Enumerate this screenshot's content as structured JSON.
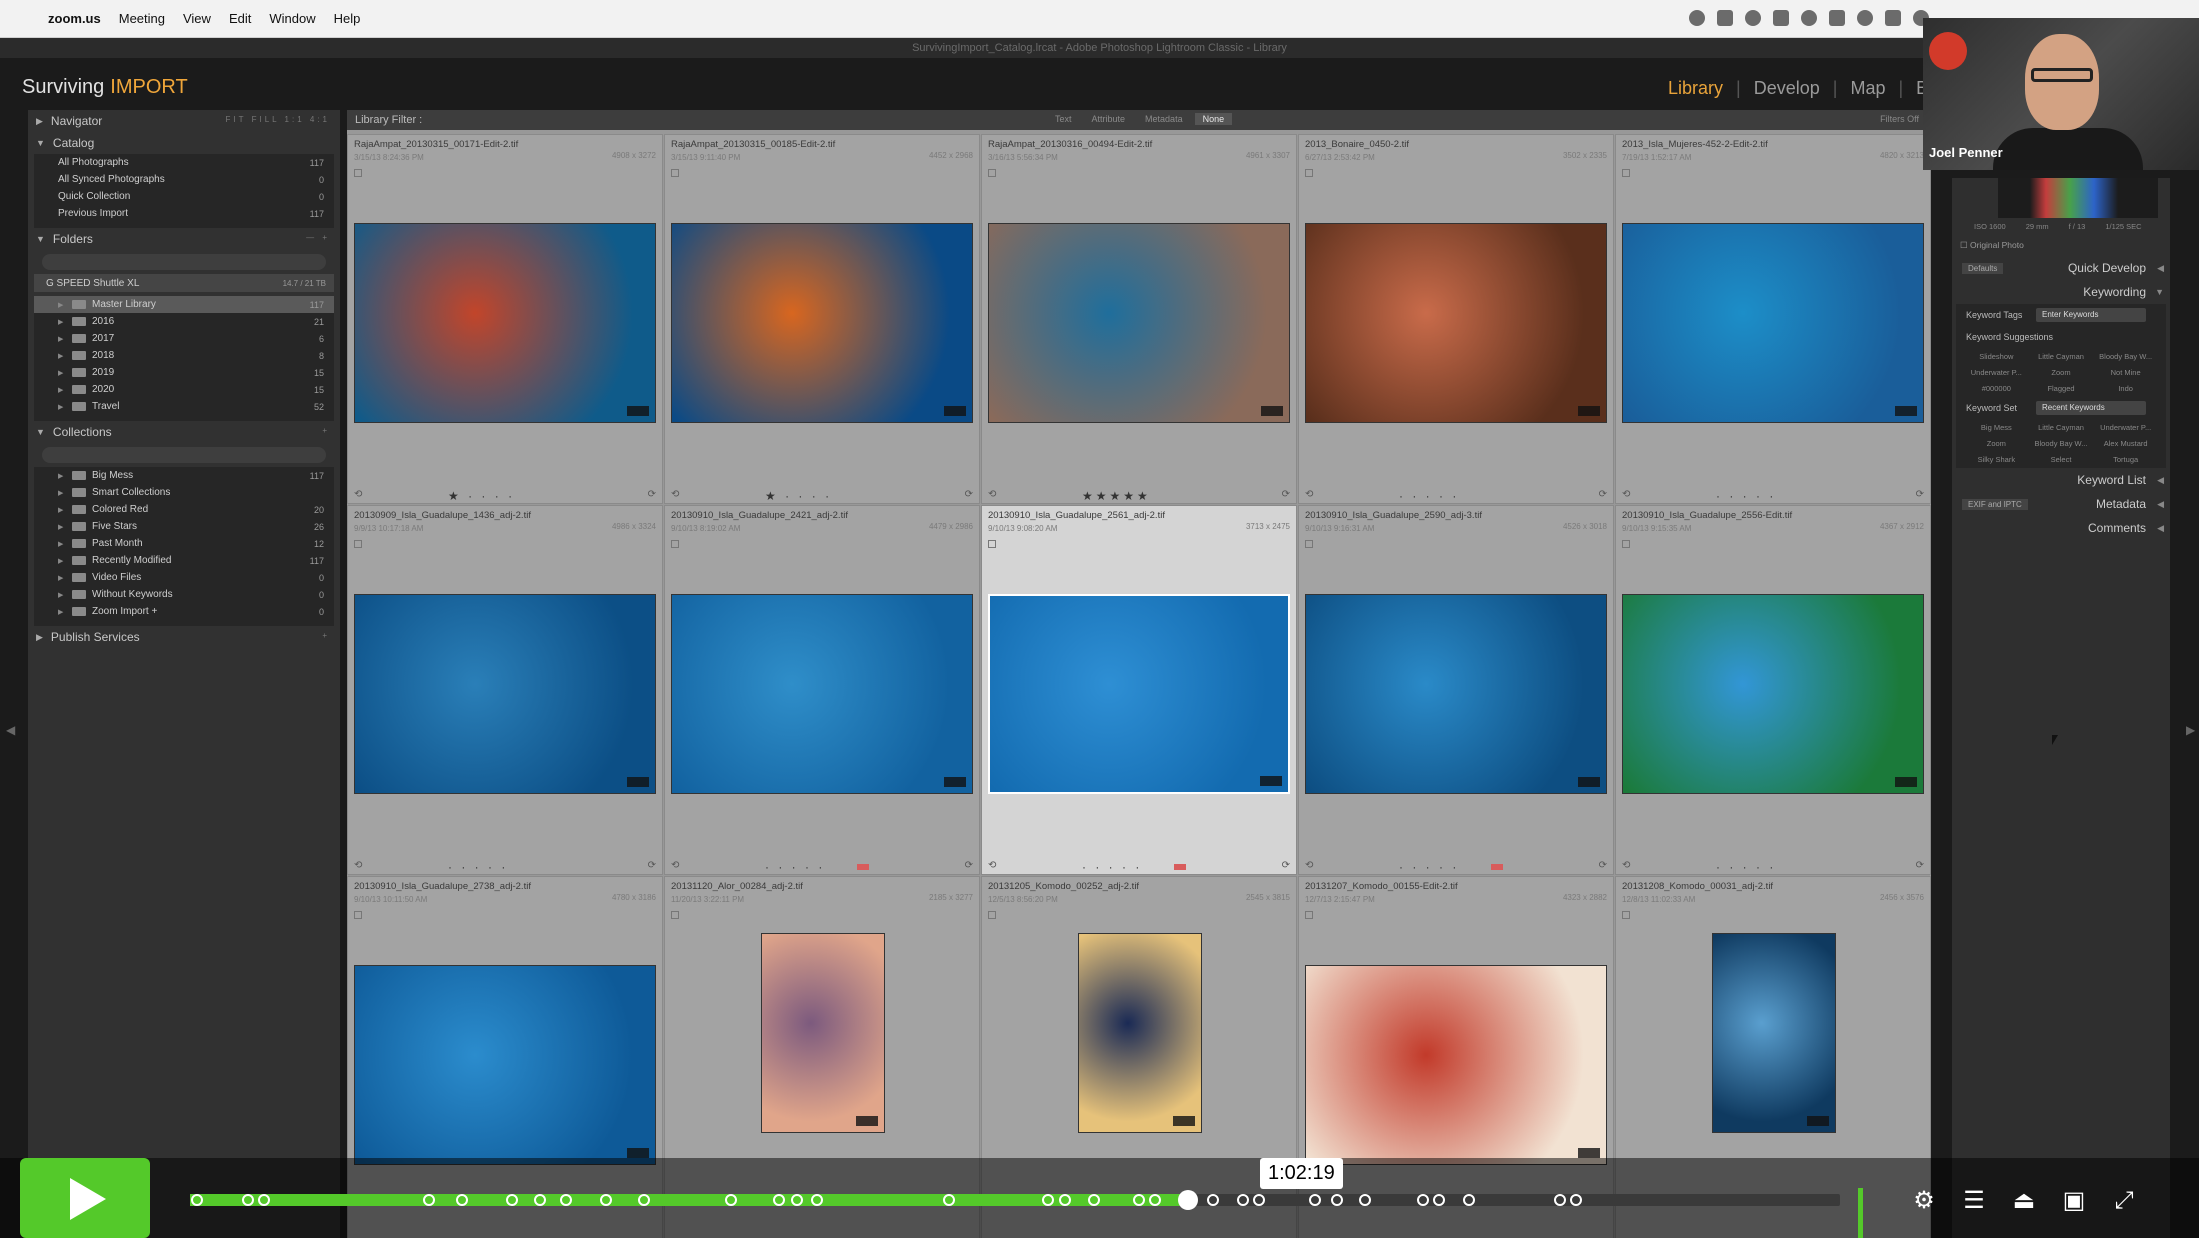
{
  "menubar": {
    "app": "zoom.us",
    "items": [
      "Meeting",
      "View",
      "Edit",
      "Window",
      "Help"
    ]
  },
  "window_title": "SurvivingImport_Catalog.lrcat - Adobe Photoshop Lightroom Classic - Library",
  "lightroom": {
    "identity_plate": "Surviving",
    "identity_plate_accent": "IMPORT",
    "modules": [
      "Library",
      "Develop",
      "Map",
      "Bo"
    ],
    "active_module": "Library",
    "left_panel": {
      "navigator": "Navigator",
      "navigator_tools": "FIT  FILL  1:1  4:1",
      "catalog": {
        "title": "Catalog",
        "items": [
          {
            "label": "All Photographs",
            "count": "117"
          },
          {
            "label": "All Synced Photographs",
            "count": "0"
          },
          {
            "label": "Quick Collection",
            "count": "0"
          },
          {
            "label": "Previous Import",
            "count": "117"
          }
        ]
      },
      "folders": {
        "title": "Folders",
        "drive": "G SPEED Shuttle XL",
        "drive_info": "14.7 / 21 TB",
        "items": [
          {
            "label": "Master Library",
            "count": "117",
            "selected": true
          },
          {
            "label": "2016",
            "count": "21"
          },
          {
            "label": "2017",
            "count": "6"
          },
          {
            "label": "2018",
            "count": "8"
          },
          {
            "label": "2019",
            "count": "15"
          },
          {
            "label": "2020",
            "count": "15"
          },
          {
            "label": "Travel",
            "count": "52"
          }
        ]
      },
      "collections": {
        "title": "Collections",
        "items": [
          {
            "label": "Big Mess",
            "count": "117"
          },
          {
            "label": "Smart Collections",
            "count": ""
          },
          {
            "label": "Colored Red",
            "count": "20"
          },
          {
            "label": "Five Stars",
            "count": "26"
          },
          {
            "label": "Past Month",
            "count": "12"
          },
          {
            "label": "Recently Modified",
            "count": "117"
          },
          {
            "label": "Video Files",
            "count": "0"
          },
          {
            "label": "Without Keywords",
            "count": "0"
          },
          {
            "label": "Zoom Import +",
            "count": "0"
          }
        ]
      },
      "publish": "Publish Services"
    },
    "filter_bar": {
      "title": "Library Filter :",
      "tabs": [
        "Text",
        "Attribute",
        "Metadata",
        "None"
      ],
      "active_tab": "None",
      "filters_off": "Filters Off"
    },
    "photos": [
      {
        "name": "RajaAmpat_20130315_00171-Edit-2.tif",
        "meta": "3/15/13 8:24:36 PM",
        "dims": "4908 x 3272",
        "stars": "★ · · · ·",
        "colors": [
          "#c2452a",
          "#0f5b8a"
        ]
      },
      {
        "name": "RajaAmpat_20130315_00185-Edit-2.tif",
        "meta": "3/15/13 9:11:40 PM",
        "dims": "4452 x 2968",
        "stars": "★ · · · ·",
        "colors": [
          "#d8661f",
          "#0a4a86"
        ]
      },
      {
        "name": "RajaAmpat_20130316_00494-Edit-2.tif",
        "meta": "3/16/13 5:56:34 PM",
        "dims": "4961 x 3307",
        "stars": "★★★★★",
        "colors": [
          "#1f6e9c",
          "#8a6a5a"
        ]
      },
      {
        "name": "2013_Bonaire_0450-2.tif",
        "meta": "6/27/13 2:53:42 PM",
        "dims": "3502 x 2335",
        "stars": "· · · · ·",
        "colors": [
          "#c96b4a",
          "#5a2f1c"
        ]
      },
      {
        "name": "2013_Isla_Mujeres-452-2-Edit-2.tif",
        "meta": "7/19/13 1:52:17 AM",
        "dims": "4820 x 3213",
        "stars": "· · · · ·",
        "colors": [
          "#1c8ec8",
          "#1a5e9a"
        ]
      },
      {
        "name": "20130909_Isla_Guadalupe_1436_adj-2.tif",
        "meta": "9/9/13 10:17:18 AM",
        "dims": "4986 x 3324",
        "stars": "· · · · ·",
        "colors": [
          "#2a7fb8",
          "#0c4f86"
        ]
      },
      {
        "name": "20130910_Isla_Guadalupe_2421_adj-2.tif",
        "meta": "9/10/13 8:19:02 AM",
        "dims": "4479 x 2986",
        "stars": "· · · · ·",
        "colors": [
          "#2f8ec9",
          "#1262a0"
        ],
        "red": true
      },
      {
        "name": "20130910_Isla_Guadalupe_2561_adj-2.tif",
        "meta": "9/10/13 9:08:20 AM",
        "dims": "3713 x 2475",
        "stars": "· · · · ·",
        "colors": [
          "#2e8fd4",
          "#136bb0"
        ],
        "red": true,
        "selected": true
      },
      {
        "name": "20130910_Isla_Guadalupe_2590_adj-3.tif",
        "meta": "9/10/13 9:16:31 AM",
        "dims": "4526 x 3018",
        "stars": "· · · · ·",
        "colors": [
          "#2a8ac8",
          "#0d4e82"
        ],
        "red": true
      },
      {
        "name": "20130910_Isla_Guadalupe_2556-Edit.tif",
        "meta": "9/10/13 9:15:35 AM",
        "dims": "4367 x 2912",
        "stars": "· · · · ·",
        "colors": [
          "#3296d6",
          "#1b7a3a"
        ]
      },
      {
        "name": "20130910_Isla_Guadalupe_2738_adj-2.tif",
        "meta": "9/10/13 10:11:50 AM",
        "dims": "4780 x 3186",
        "stars": "",
        "colors": [
          "#2b8ccd",
          "#0e5a98"
        ]
      },
      {
        "name": "20131120_Alor_00284_adj-2.tif",
        "meta": "11/20/13 3:22:11 PM",
        "dims": "2185 x 3277",
        "stars": "",
        "colors": [
          "#7c5a7e",
          "#e0a58a"
        ]
      },
      {
        "name": "20131205_Komodo_00252_adj-2.tif",
        "meta": "12/5/13 8:56:20 PM",
        "dims": "2545 x 3815",
        "stars": "",
        "colors": [
          "#1a2a55",
          "#e6c27a"
        ]
      },
      {
        "name": "20131207_Komodo_00155-Edit-2.tif",
        "meta": "12/7/13 2:15:47 PM",
        "dims": "4323 x 2882",
        "stars": "",
        "colors": [
          "#c23a2a",
          "#f2e2d2"
        ]
      },
      {
        "name": "20131208_Komodo_00031_adj-2.tif",
        "meta": "12/8/13 11:02:33 AM",
        "dims": "2456 x 3576",
        "stars": "",
        "colors": [
          "#5a9fcf",
          "#0f3a60"
        ]
      }
    ],
    "right_panel": {
      "histogram_info": [
        "ISO 1600",
        "29 mm",
        "f / 13",
        "1/125 SEC"
      ],
      "original_photo": "Original Photo",
      "quick_develop": "Quick Develop",
      "defaults": "Defaults",
      "keywording": "Keywording",
      "keyword_tags_label": "Keyword Tags",
      "keyword_tags_value": "Enter Keywords",
      "keyword_suggestions": "Keyword Suggestions",
      "suggestions": [
        "Slideshow",
        "Little Cayman",
        "Bloody Bay W...",
        "Underwater P...",
        "Zoom",
        "Not Mine",
        "#000000",
        "Flagged",
        "Indo"
      ],
      "keyword_set_label": "Keyword Set",
      "keyword_set_value": "Recent Keywords",
      "keyword_set": [
        "Big Mess",
        "Little Cayman",
        "Underwater P...",
        "Zoom",
        "Bloody Bay W...",
        "Alex Mustard",
        "Silky Shark",
        "Select",
        "Tortuga"
      ],
      "keyword_list": "Keyword List",
      "metadata_preset": "EXIF and IPTC",
      "metadata": "Metadata",
      "comments": "Comments"
    }
  },
  "video": {
    "speaker": "Joel Penner"
  },
  "player": {
    "time": "1:02:19",
    "progress": 0.605
  }
}
